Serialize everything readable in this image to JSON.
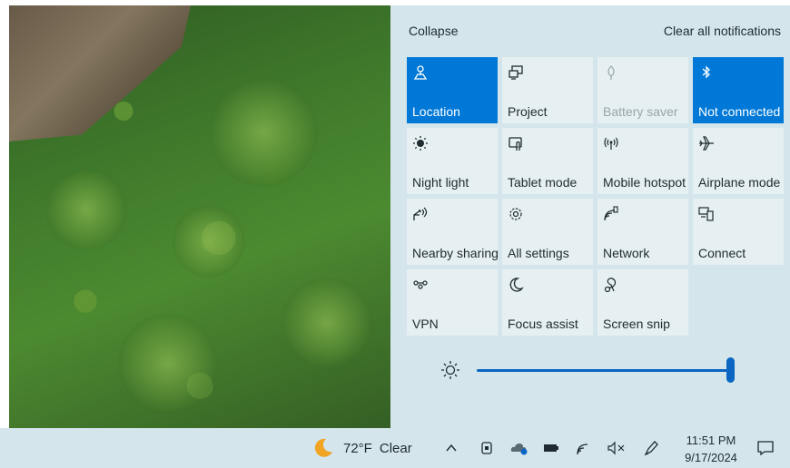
{
  "action_center": {
    "collapse_label": "Collapse",
    "clear_label": "Clear all notifications",
    "tiles": [
      {
        "label": "Location",
        "icon": "location-icon",
        "state": "on"
      },
      {
        "label": "Project",
        "icon": "project-icon",
        "state": "off"
      },
      {
        "label": "Battery saver",
        "icon": "battery-saver-icon",
        "state": "disabled"
      },
      {
        "label": "Not connected",
        "icon": "bluetooth-icon",
        "state": "on"
      },
      {
        "label": "Night light",
        "icon": "night-light-icon",
        "state": "off"
      },
      {
        "label": "Tablet mode",
        "icon": "tablet-mode-icon",
        "state": "off"
      },
      {
        "label": "Mobile hotspot",
        "icon": "mobile-hotspot-icon",
        "state": "off"
      },
      {
        "label": "Airplane mode",
        "icon": "airplane-icon",
        "state": "off"
      },
      {
        "label": "Nearby sharing",
        "icon": "nearby-sharing-icon",
        "state": "off"
      },
      {
        "label": "All settings",
        "icon": "gear-icon",
        "state": "off"
      },
      {
        "label": "Network",
        "icon": "network-icon",
        "state": "off"
      },
      {
        "label": "Connect",
        "icon": "connect-icon",
        "state": "off"
      },
      {
        "label": "VPN",
        "icon": "vpn-icon",
        "state": "off"
      },
      {
        "label": "Focus assist",
        "icon": "moon-icon",
        "state": "off"
      },
      {
        "label": "Screen snip",
        "icon": "screen-snip-icon",
        "state": "off"
      }
    ],
    "brightness": {
      "level": 1.0,
      "icon": "sun-icon"
    },
    "accent_color": "#0078d7"
  },
  "taskbar": {
    "weather": {
      "temp": "72°F",
      "condition": "Clear",
      "icon": "moon-weather-icon"
    },
    "tray_icons": [
      "chevron-up-icon",
      "meet-now-icon",
      "onedrive-icon",
      "battery-icon",
      "network-icon",
      "volume-muted-icon",
      "pen-icon"
    ],
    "time": "11:51 PM",
    "date": "9/17/2024",
    "notification_icon": "notification-icon"
  }
}
